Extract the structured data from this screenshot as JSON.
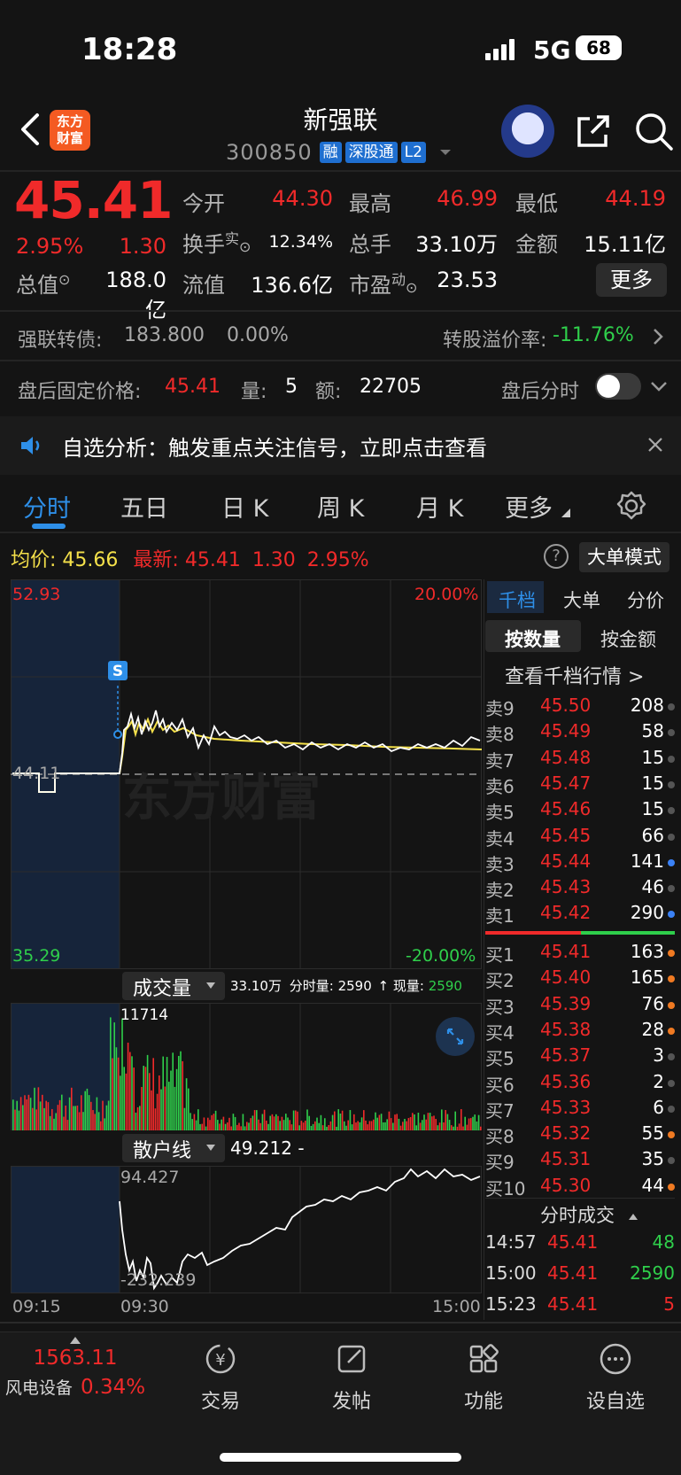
{
  "status_bar": {
    "time": "18:28",
    "network": "5G",
    "battery": "68"
  },
  "header": {
    "logo_line1": "东方",
    "logo_line2": "财富",
    "stock_name": "新强联",
    "stock_code": "300850",
    "tags": [
      "融",
      "深股通",
      "L2"
    ]
  },
  "quote": {
    "price": "45.41",
    "change_pct": "2.95%",
    "change_amt": "1.30",
    "open_label": "今开",
    "open": "44.30",
    "high_label": "最高",
    "high": "46.99",
    "low_label": "最低",
    "low": "44.19",
    "turnover_label": "换手",
    "turnover_sup": "实",
    "turnover": "12.34%",
    "volume_label": "总手",
    "volume": "33.10万",
    "amount_label": "金额",
    "amount": "15.11亿",
    "mcap_label": "总值",
    "mcap": "188.0亿",
    "float_label": "流值",
    "float_cap": "136.6亿",
    "pe_label": "市盈",
    "pe_sup": "动",
    "pe": "23.53",
    "more_label": "更多"
  },
  "convertible": {
    "label": "强联转债:",
    "price": "183.800",
    "pct": "0.00%",
    "premium_label": "转股溢价率:",
    "premium": "-11.76%"
  },
  "after_hours": {
    "price_label": "盘后固定价格:",
    "price": "45.41",
    "vol_label": "量:",
    "vol": "5",
    "amt_label": "额:",
    "amt": "22705",
    "timeshare_label": "盘后分时"
  },
  "notice": {
    "text": "自选分析：触发重点关注信号，立即点击查看"
  },
  "tabs": [
    "分时",
    "五日",
    "日 K",
    "周 K",
    "月 K",
    "更多"
  ],
  "chart_header": {
    "avg_label": "均价:",
    "avg": "45.66",
    "latest_label": "最新:",
    "latest": "45.41",
    "latest_chg": "1.30",
    "latest_pct": "2.95%",
    "bigorder_label": "大单模式"
  },
  "price_chart": {
    "top_price": "52.93",
    "bottom_price": "35.29",
    "top_pct": "20.00%",
    "bottom_pct": "-20.00%",
    "ref_price": "44.11",
    "signal": "S",
    "watermark": "东方财富"
  },
  "volume_chart": {
    "label": "成交量",
    "summary": "33.10万",
    "timeshare_label": "分时量:",
    "timeshare_vol": "2590",
    "now_label": "现量:",
    "now_vol": "2590",
    "max_label": "11714"
  },
  "retail_chart": {
    "label": "散户线",
    "value": "49.212 -",
    "top_label": "94.427",
    "bottom_label": "-232.239"
  },
  "time_axis": {
    "start": "09:15",
    "open": "09:30",
    "end": "15:00"
  },
  "order_book": {
    "tabs": [
      "千档",
      "大单",
      "分价"
    ],
    "subtabs": [
      "按数量",
      "按金额"
    ],
    "view_more": "查看千档行情 >",
    "asks": [
      {
        "name": "卖9",
        "price": "45.50",
        "vol": "208",
        "dot": "#555555"
      },
      {
        "name": "卖8",
        "price": "45.49",
        "vol": "58",
        "dot": "#555555"
      },
      {
        "name": "卖7",
        "price": "45.48",
        "vol": "15",
        "dot": "#555555"
      },
      {
        "name": "卖6",
        "price": "45.47",
        "vol": "15",
        "dot": "#555555"
      },
      {
        "name": "卖5",
        "price": "45.46",
        "vol": "15",
        "dot": "#555555"
      },
      {
        "name": "卖4",
        "price": "45.45",
        "vol": "66",
        "dot": "#555555"
      },
      {
        "name": "卖3",
        "price": "45.44",
        "vol": "141",
        "dot": "#3b82f6"
      },
      {
        "name": "卖2",
        "price": "45.43",
        "vol": "46",
        "dot": "#555555"
      },
      {
        "name": "卖1",
        "price": "45.42",
        "vol": "290",
        "dot": "#3b82f6"
      }
    ],
    "bids": [
      {
        "name": "买1",
        "price": "45.41",
        "vol": "163",
        "dot": "#f07a22"
      },
      {
        "name": "买2",
        "price": "45.40",
        "vol": "165",
        "dot": "#f07a22"
      },
      {
        "name": "买3",
        "price": "45.39",
        "vol": "76",
        "dot": "#f07a22"
      },
      {
        "name": "买4",
        "price": "45.38",
        "vol": "28",
        "dot": "#f07a22"
      },
      {
        "name": "买5",
        "price": "45.37",
        "vol": "3",
        "dot": "#555555"
      },
      {
        "name": "买6",
        "price": "45.36",
        "vol": "2",
        "dot": "#555555"
      },
      {
        "name": "买7",
        "price": "45.33",
        "vol": "6",
        "dot": "#555555"
      },
      {
        "name": "买8",
        "price": "45.32",
        "vol": "55",
        "dot": "#f07a22"
      },
      {
        "name": "买9",
        "price": "45.31",
        "vol": "35",
        "dot": "#555555"
      },
      {
        "name": "买10",
        "price": "45.30",
        "vol": "44",
        "dot": "#f07a22"
      }
    ],
    "ticks_label": "分时成交",
    "ticks": [
      {
        "time": "14:57",
        "price": "45.41",
        "vol": "48",
        "color": "#2fcf4b"
      },
      {
        "time": "15:00",
        "price": "45.41",
        "vol": "2590",
        "color": "#2fcf4b"
      },
      {
        "time": "15:23",
        "price": "45.41",
        "vol": "5",
        "color": "#f02a2a"
      }
    ]
  },
  "bottom_nav": {
    "sector_value": "1563.11",
    "sector_name": "风电设备",
    "sector_pct": "0.34%",
    "items": [
      "交易",
      "发帖",
      "功能",
      "设自选"
    ]
  },
  "colors": {
    "up": "#f02a2a",
    "down": "#2fcf4b",
    "accent": "#2e8fe8",
    "avg_line": "#f4e04a"
  }
}
